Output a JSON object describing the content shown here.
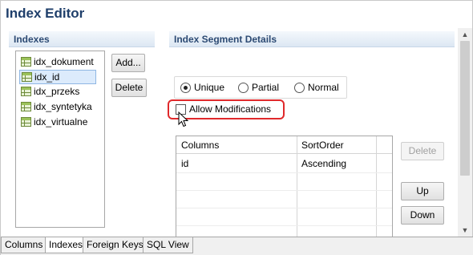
{
  "editor": {
    "title": "Index Editor"
  },
  "indexes_panel": {
    "header": "Indexes",
    "items": [
      "idx_dokument",
      "idx_id",
      "idx_przeks",
      "idx_syntetyka",
      "idx_virtualne"
    ],
    "selected": "idx_id",
    "add_label": "Add...",
    "delete_label": "Delete"
  },
  "details_panel": {
    "header": "Index Segment Details",
    "radio": {
      "unique": "Unique",
      "partial": "Partial",
      "normal": "Normal",
      "selected": "Unique"
    },
    "allow_modifications": {
      "label": "Allow Modifications",
      "checked": false,
      "highlight_color": "#e0292b"
    },
    "grid": {
      "columns": [
        "Columns",
        "SortOrder"
      ],
      "rows": [
        [
          "id",
          "Ascending"
        ]
      ]
    },
    "delete_label": "Delete",
    "up_label": "Up",
    "down_label": "Down"
  },
  "tabs": {
    "items": [
      "Columns",
      "Indexes",
      "Foreign Keys",
      "SQL View"
    ],
    "active": "Indexes"
  },
  "colors": {
    "title": "#1f3f6b",
    "header_text": "#2c4a73",
    "selection": "#dcebfc"
  },
  "icons": {
    "index_item": "table-icon",
    "cursor": "mouse-pointer-icon"
  }
}
